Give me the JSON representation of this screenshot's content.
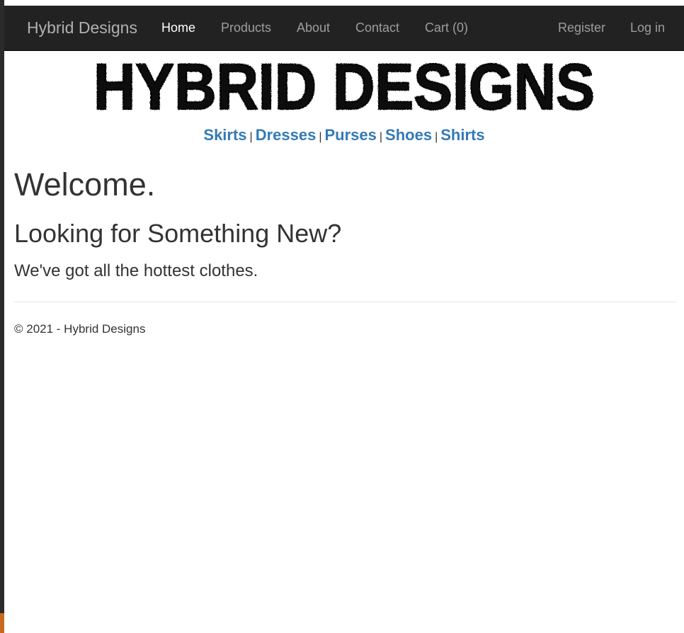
{
  "navbar": {
    "brand": "Hybrid Designs",
    "links": [
      {
        "label": "Home",
        "active": true
      },
      {
        "label": "Products"
      },
      {
        "label": "About"
      },
      {
        "label": "Contact"
      },
      {
        "label": "Cart (0)"
      }
    ],
    "account": [
      {
        "label": "Register"
      },
      {
        "label": "Log in"
      }
    ]
  },
  "logo": {
    "text": "HYBRID DESIGNS"
  },
  "categories": {
    "items": [
      "Skirts",
      "Dresses",
      "Purses",
      "Shoes",
      "Shirts"
    ],
    "separator": "|"
  },
  "main": {
    "heading": "Welcome.",
    "subheading": "Looking for Something New?",
    "lead": "We've got all the hottest clothes."
  },
  "footer": {
    "copyright": "© 2021 - Hybrid Designs"
  },
  "colors": {
    "navbar_bg": "#222222",
    "nav_link": "#9d9d9d",
    "nav_link_active": "#ffffff",
    "link_blue": "#337ab7",
    "text": "#333333"
  }
}
